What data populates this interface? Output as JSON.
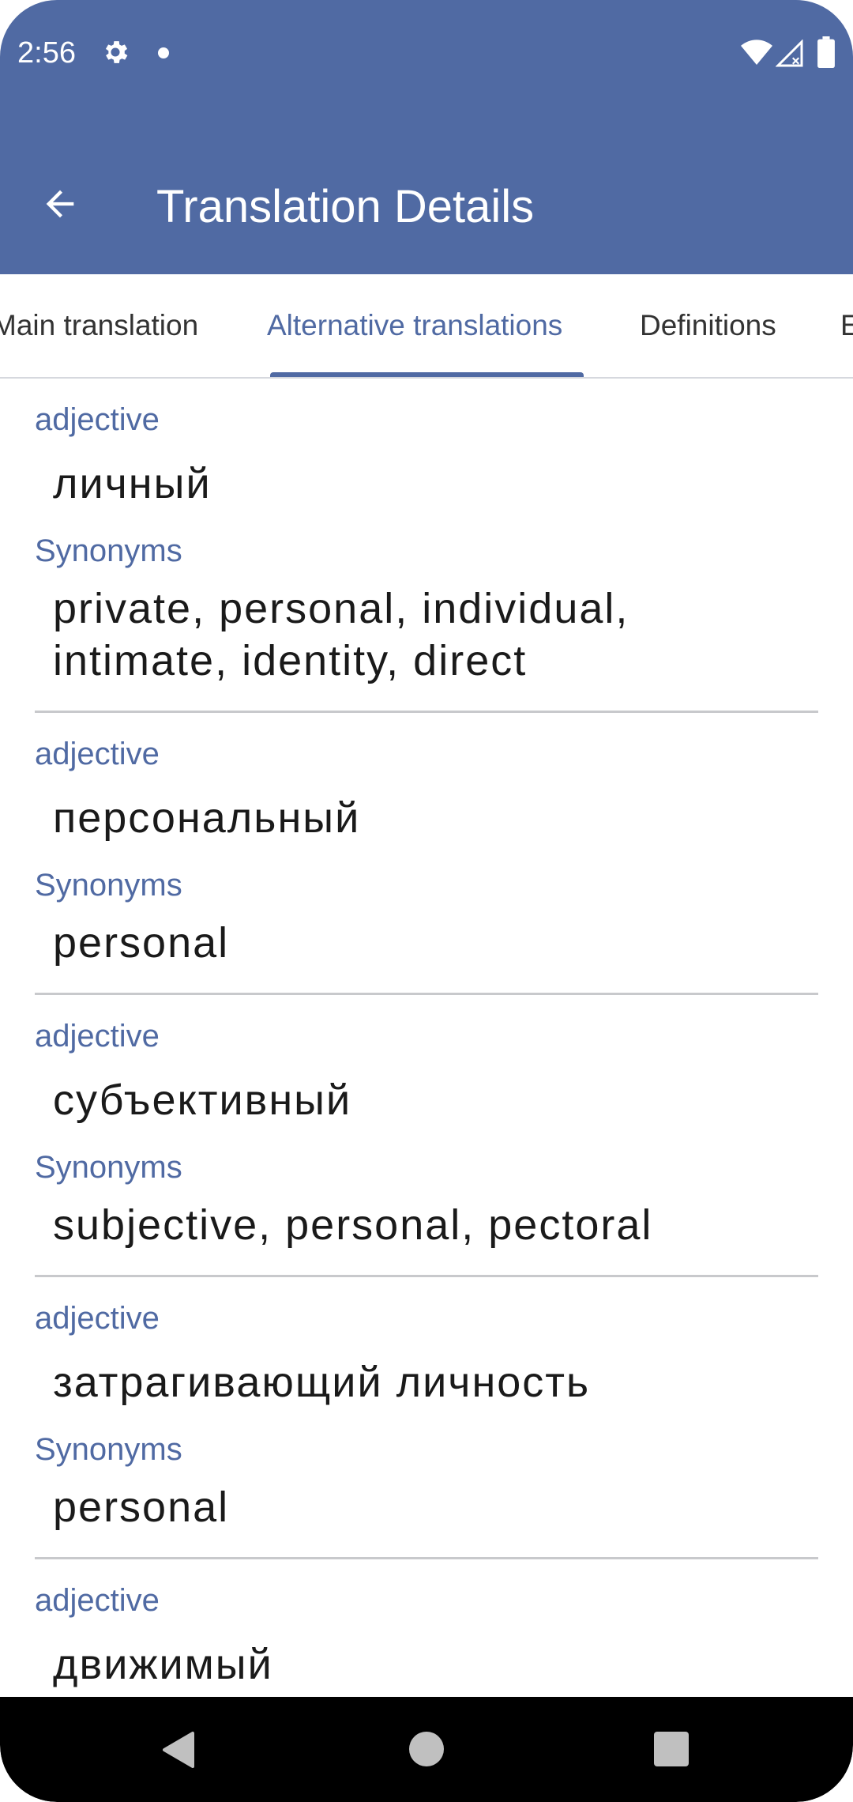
{
  "status_bar": {
    "time": "2:56",
    "icons": [
      "settings-gear-icon",
      "notification-dot-icon",
      "wifi-icon",
      "cellular-signal-icon",
      "battery-icon"
    ]
  },
  "toolbar": {
    "back_icon": "arrow-back-icon",
    "title": "Translation Details"
  },
  "tabs": [
    {
      "label": "Main translation",
      "active": false
    },
    {
      "label": "Alternative translations",
      "active": true
    },
    {
      "label": "Definitions",
      "active": false
    },
    {
      "label": "E",
      "active": false
    }
  ],
  "entries": [
    {
      "pos": "adjective",
      "word": "личный",
      "synonyms_label": "Synonyms",
      "synonyms": "private, personal, individual, intimate, identity, direct"
    },
    {
      "pos": "adjective",
      "word": "персональный",
      "synonyms_label": "Synonyms",
      "synonyms": "personal"
    },
    {
      "pos": "adjective",
      "word": "субъективный",
      "synonyms_label": "Synonyms",
      "synonyms": "subjective, personal, pectoral"
    },
    {
      "pos": "adjective",
      "word": "затрагивающий личность",
      "synonyms_label": "Synonyms",
      "synonyms": "personal"
    },
    {
      "pos": "adjective",
      "word": "движимый"
    }
  ],
  "nav_bar": {
    "icons": [
      "nav-back-icon",
      "nav-home-icon",
      "nav-recents-icon"
    ]
  },
  "colors": {
    "primary": "#506aa3",
    "text": "#1a1a1a",
    "divider": "#c8c9cc"
  }
}
